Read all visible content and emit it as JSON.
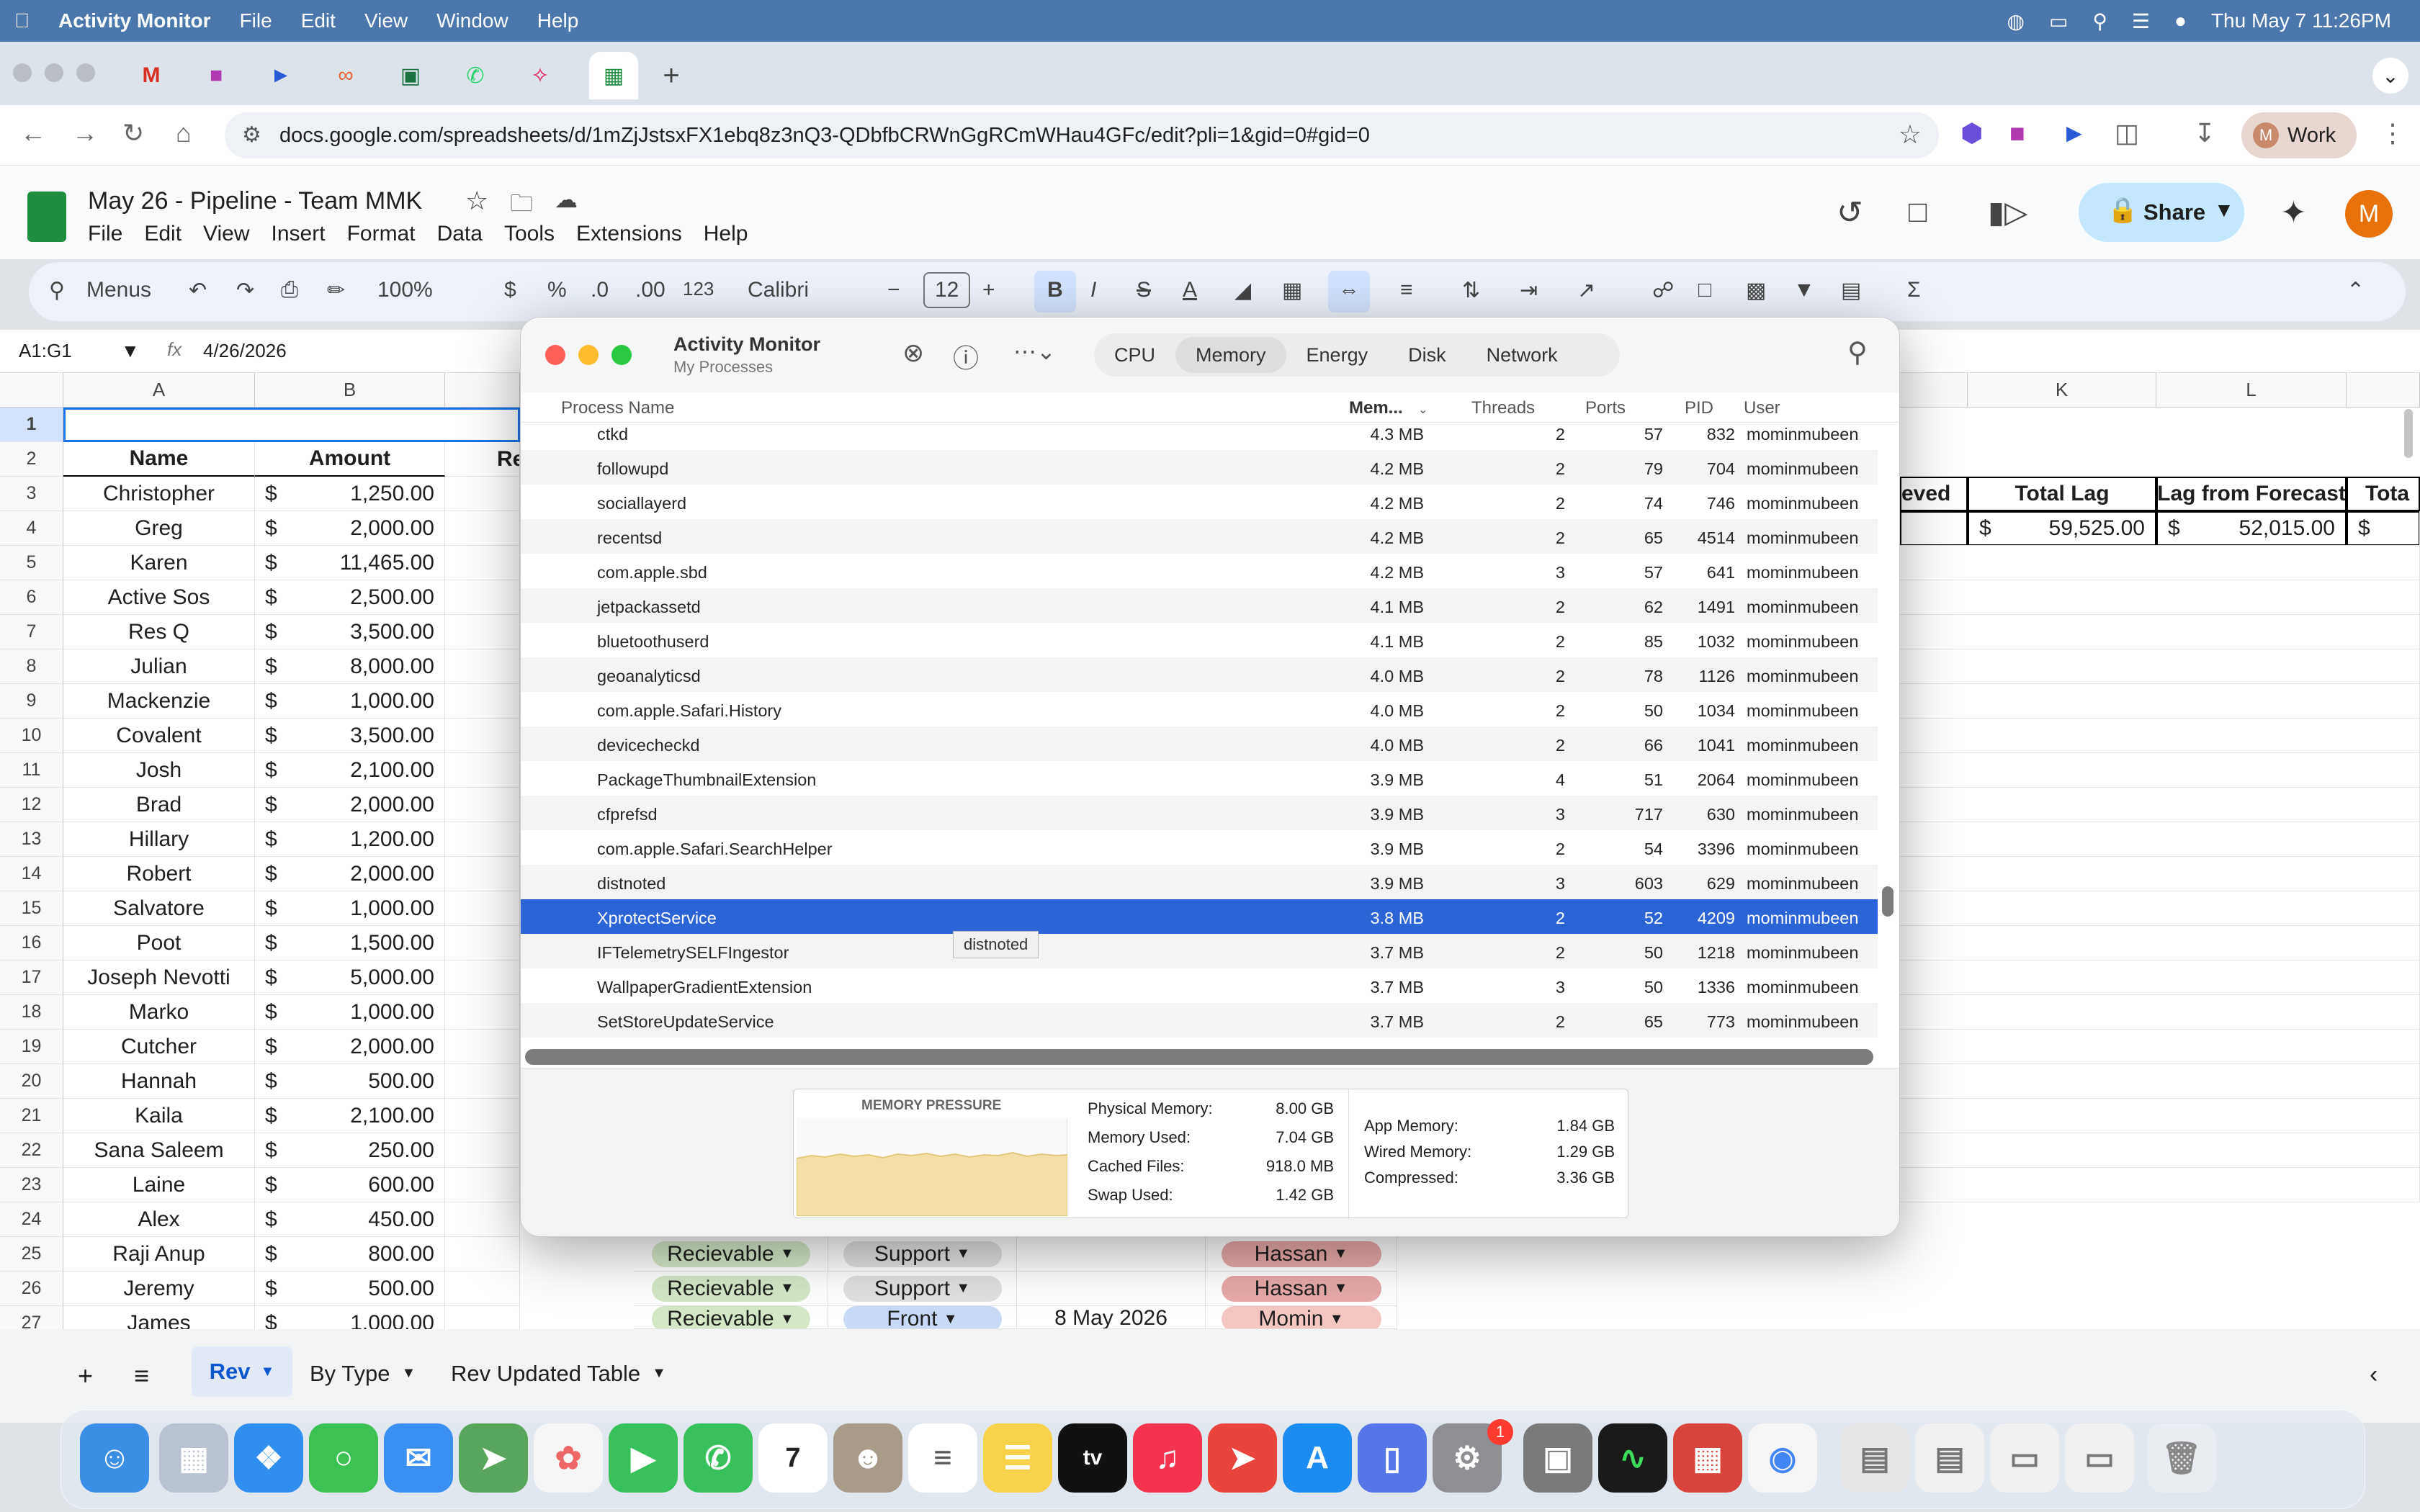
{
  "menubar": {
    "app": "Activity Monitor",
    "items": [
      "File",
      "Edit",
      "View",
      "Window",
      "Help"
    ],
    "clock": "Thu May 7  11:26PM"
  },
  "browser": {
    "url": "docs.google.com/spreadsheets/d/1mZjJstsxFX1ebq8z3nQ3-QDbfbCRWnGgRCmWHau4GFc/edit?pli=1&gid=0#gid=0",
    "profile": "Work"
  },
  "sheet": {
    "title": "May 26 - Pipeline - Team MMK",
    "menu": [
      "File",
      "Edit",
      "View",
      "Insert",
      "Format",
      "Data",
      "Tools",
      "Extensions",
      "Help"
    ],
    "share": "Share",
    "toolbar": {
      "menus": "Menus",
      "zoom": "100%",
      "currency": "$",
      "percent": "%",
      "dec_less": ".0",
      "dec_more": ".00",
      "num_fmt": "123",
      "font": "Calibri",
      "size": "12"
    },
    "namebox": "A1:G1",
    "formula": "4/26/2026",
    "cols": {
      "A": "A",
      "B": "B",
      "K": "K",
      "L": "L"
    },
    "hdr_name": "Name",
    "hdr_amount": "Amount",
    "hdr_re": "Re",
    "hdr_eved": "eved",
    "hdr_totallag": "Total Lag",
    "hdr_lagforecast": "Lag from Forecast",
    "hdr_tota": "Tota",
    "total_lag": "59,525.00",
    "lag_forecast": "52,015.00",
    "dollar": "$",
    "rows": [
      {
        "n": "3",
        "name": "Christopher",
        "amt": "1,250.00"
      },
      {
        "n": "4",
        "name": "Greg",
        "amt": "2,000.00"
      },
      {
        "n": "5",
        "name": "Karen",
        "amt": "11,465.00"
      },
      {
        "n": "6",
        "name": "Active Sos",
        "amt": "2,500.00"
      },
      {
        "n": "7",
        "name": "Res Q",
        "amt": "3,500.00"
      },
      {
        "n": "8",
        "name": "Julian",
        "amt": "8,000.00"
      },
      {
        "n": "9",
        "name": "Mackenzie",
        "amt": "1,000.00"
      },
      {
        "n": "10",
        "name": "Covalent",
        "amt": "3,500.00"
      },
      {
        "n": "11",
        "name": "Josh",
        "amt": "2,100.00"
      },
      {
        "n": "12",
        "name": "Brad",
        "amt": "2,000.00"
      },
      {
        "n": "13",
        "name": "Hillary",
        "amt": "1,200.00"
      },
      {
        "n": "14",
        "name": "Robert",
        "amt": "2,000.00"
      },
      {
        "n": "15",
        "name": "Salvatore",
        "amt": "1,000.00"
      },
      {
        "n": "16",
        "name": "Poot",
        "amt": "1,500.00"
      },
      {
        "n": "17",
        "name": "Joseph Nevotti",
        "amt": "5,000.00"
      },
      {
        "n": "18",
        "name": "Marko",
        "amt": "1,000.00"
      },
      {
        "n": "19",
        "name": "Cutcher",
        "amt": "2,000.00"
      },
      {
        "n": "20",
        "name": "Hannah",
        "amt": "500.00"
      },
      {
        "n": "21",
        "name": "Kaila",
        "amt": "2,100.00"
      },
      {
        "n": "22",
        "name": "Sana Saleem",
        "amt": "250.00"
      },
      {
        "n": "23",
        "name": "Laine",
        "amt": "600.00"
      },
      {
        "n": "24",
        "name": "Alex",
        "amt": "450.00"
      },
      {
        "n": "25",
        "name": "Raji Anup",
        "amt": "800.00"
      },
      {
        "n": "26",
        "name": "Jeremy",
        "amt": "500.00"
      },
      {
        "n": "27",
        "name": "James",
        "amt": "1,000.00"
      }
    ],
    "row1": "1",
    "row2": "2",
    "visible_status": [
      {
        "status": "Recievable",
        "type": "Support",
        "owner": "Hassan",
        "date": ""
      },
      {
        "status": "Recievable",
        "type": "Support",
        "owner": "Hassan",
        "date": ""
      },
      {
        "status": "Recievable",
        "type": "Front",
        "owner": "Momin",
        "date": "8 May 2026"
      }
    ],
    "tabs": [
      "Rev",
      "By Type",
      "Rev Updated Table"
    ]
  },
  "am": {
    "title": "Activity Monitor",
    "subtitle": "My Processes",
    "segments": [
      "CPU",
      "Memory",
      "Energy",
      "Disk",
      "Network"
    ],
    "columns": {
      "name": "Process Name",
      "mem": "Mem...",
      "threads": "Threads",
      "ports": "Ports",
      "pid": "PID",
      "user": "User"
    },
    "processes": [
      {
        "name": "ctkd",
        "mem": "4.3 MB",
        "threads": "2",
        "ports": "57",
        "pid": "832",
        "user": "mominmubeen"
      },
      {
        "name": "followupd",
        "mem": "4.2 MB",
        "threads": "2",
        "ports": "79",
        "pid": "704",
        "user": "mominmubeen"
      },
      {
        "name": "sociallayerd",
        "mem": "4.2 MB",
        "threads": "2",
        "ports": "74",
        "pid": "746",
        "user": "mominmubeen"
      },
      {
        "name": "recentsd",
        "mem": "4.2 MB",
        "threads": "2",
        "ports": "65",
        "pid": "4514",
        "user": "mominmubeen"
      },
      {
        "name": "com.apple.sbd",
        "mem": "4.2 MB",
        "threads": "3",
        "ports": "57",
        "pid": "641",
        "user": "mominmubeen"
      },
      {
        "name": "jetpackassetd",
        "mem": "4.1 MB",
        "threads": "2",
        "ports": "62",
        "pid": "1491",
        "user": "mominmubeen"
      },
      {
        "name": "bluetoothuserd",
        "mem": "4.1 MB",
        "threads": "2",
        "ports": "85",
        "pid": "1032",
        "user": "mominmubeen"
      },
      {
        "name": "geoanalyticsd",
        "mem": "4.0 MB",
        "threads": "2",
        "ports": "78",
        "pid": "1126",
        "user": "mominmubeen"
      },
      {
        "name": "com.apple.Safari.History",
        "mem": "4.0 MB",
        "threads": "2",
        "ports": "50",
        "pid": "1034",
        "user": "mominmubeen"
      },
      {
        "name": "devicecheckd",
        "mem": "4.0 MB",
        "threads": "2",
        "ports": "66",
        "pid": "1041",
        "user": "mominmubeen"
      },
      {
        "name": "PackageThumbnailExtension",
        "mem": "3.9 MB",
        "threads": "4",
        "ports": "51",
        "pid": "2064",
        "user": "mominmubeen"
      },
      {
        "name": "cfprefsd",
        "mem": "3.9 MB",
        "threads": "3",
        "ports": "717",
        "pid": "630",
        "user": "mominmubeen"
      },
      {
        "name": "com.apple.Safari.SearchHelper",
        "mem": "3.9 MB",
        "threads": "2",
        "ports": "54",
        "pid": "3396",
        "user": "mominmubeen"
      },
      {
        "name": "distnoted",
        "mem": "3.9 MB",
        "threads": "3",
        "ports": "603",
        "pid": "629",
        "user": "mominmubeen"
      },
      {
        "name": "XprotectService",
        "mem": "3.8 MB",
        "threads": "2",
        "ports": "52",
        "pid": "4209",
        "user": "mominmubeen"
      },
      {
        "name": "IFTelemetrySELFIngestor",
        "mem": "3.7 MB",
        "threads": "2",
        "ports": "50",
        "pid": "1218",
        "user": "mominmubeen"
      },
      {
        "name": "WallpaperGradientExtension",
        "mem": "3.7 MB",
        "threads": "3",
        "ports": "50",
        "pid": "1336",
        "user": "mominmubeen"
      },
      {
        "name": "SetStoreUpdateService",
        "mem": "3.7 MB",
        "threads": "2",
        "ports": "65",
        "pid": "773",
        "user": "mominmubeen"
      }
    ],
    "selected_index": 14,
    "tooltip": "distnoted",
    "memory_pressure": "MEMORY PRESSURE",
    "stats": {
      "physical_label": "Physical Memory:",
      "physical": "8.00 GB",
      "used_label": "Memory Used:",
      "used": "7.04 GB",
      "cached_label": "Cached Files:",
      "cached": "918.0 MB",
      "swap_label": "Swap Used:",
      "swap": "1.42 GB",
      "app_label": "App Memory:",
      "app": "1.84 GB",
      "wired_label": "Wired Memory:",
      "wired": "1.29 GB",
      "comp_label": "Compressed:",
      "comp": "3.36 GB"
    }
  },
  "colors": {
    "menubar": "#4a78ad",
    "selection": "#2a64d6",
    "pressure_fill": "#f3dfa8",
    "receivable": "#d4e8c8",
    "hassan": "#e8a9a9",
    "support": "#e1e1e1"
  }
}
